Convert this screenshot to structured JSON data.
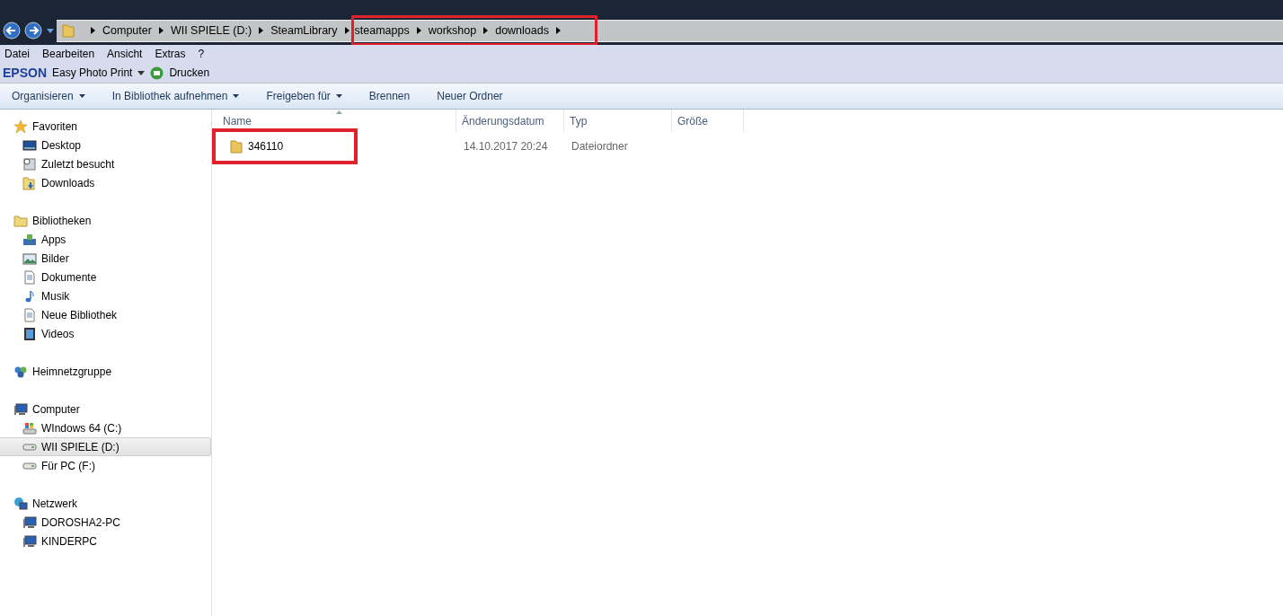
{
  "address_bar": {
    "segments": [
      "Computer",
      "WII SPIELE (D:)",
      "SteamLibrary"
    ],
    "highlighted_segments": [
      "steamapps",
      "workshop",
      "downloads"
    ]
  },
  "menu_bar": [
    "Datei",
    "Bearbeiten",
    "Ansicht",
    "Extras",
    "?"
  ],
  "epson_bar": {
    "brand": "EPSON",
    "app": "Easy Photo Print",
    "print": "Drucken"
  },
  "toolbar": [
    {
      "label": "Organisieren",
      "dropdown": true
    },
    {
      "label": "In Bibliothek aufnehmen",
      "dropdown": true
    },
    {
      "label": "Freigeben für",
      "dropdown": true
    },
    {
      "label": "Brennen",
      "dropdown": false
    },
    {
      "label": "Neuer Ordner",
      "dropdown": false
    }
  ],
  "sidebar": {
    "groups": [
      {
        "label": "Favoriten",
        "kind": "star",
        "items": [
          {
            "label": "Desktop",
            "kind": "desktop",
            "selected": false
          },
          {
            "label": "Zuletzt besucht",
            "kind": "recent",
            "selected": false
          },
          {
            "label": "Downloads",
            "kind": "downloads",
            "selected": false
          }
        ]
      },
      {
        "label": "Bibliotheken",
        "kind": "library",
        "items": [
          {
            "label": "Apps",
            "kind": "apps",
            "selected": false
          },
          {
            "label": "Bilder",
            "kind": "pictures",
            "selected": false
          },
          {
            "label": "Dokumente",
            "kind": "document",
            "selected": false
          },
          {
            "label": "Musik",
            "kind": "music",
            "selected": false
          },
          {
            "label": "Neue Bibliothek",
            "kind": "document",
            "selected": false
          },
          {
            "label": "Videos",
            "kind": "video",
            "selected": false
          }
        ]
      },
      {
        "label": "Heimnetzgruppe",
        "kind": "homegroup"
      },
      {
        "label": "Computer",
        "kind": "computer",
        "items": [
          {
            "label": "WIndows 64 (C:)",
            "kind": "windows-drive",
            "selected": false
          },
          {
            "label": "WII SPIELE (D:)",
            "kind": "drive",
            "selected": true
          },
          {
            "label": "Für PC (F:)",
            "kind": "drive",
            "selected": false
          }
        ]
      },
      {
        "label": "Netzwerk",
        "kind": "network",
        "items": [
          {
            "label": "DOROSHA2-PC",
            "kind": "computer",
            "selected": false
          },
          {
            "label": "KINDERPC",
            "kind": "computer",
            "selected": false
          }
        ]
      }
    ]
  },
  "table": {
    "columns": [
      "Name",
      "Änderungsdatum",
      "Typ",
      "Größe"
    ],
    "rows": [
      {
        "name": "346110",
        "date": "14.10.2017 20:24",
        "type": "Dateiordner",
        "highlighted": true
      }
    ]
  }
}
